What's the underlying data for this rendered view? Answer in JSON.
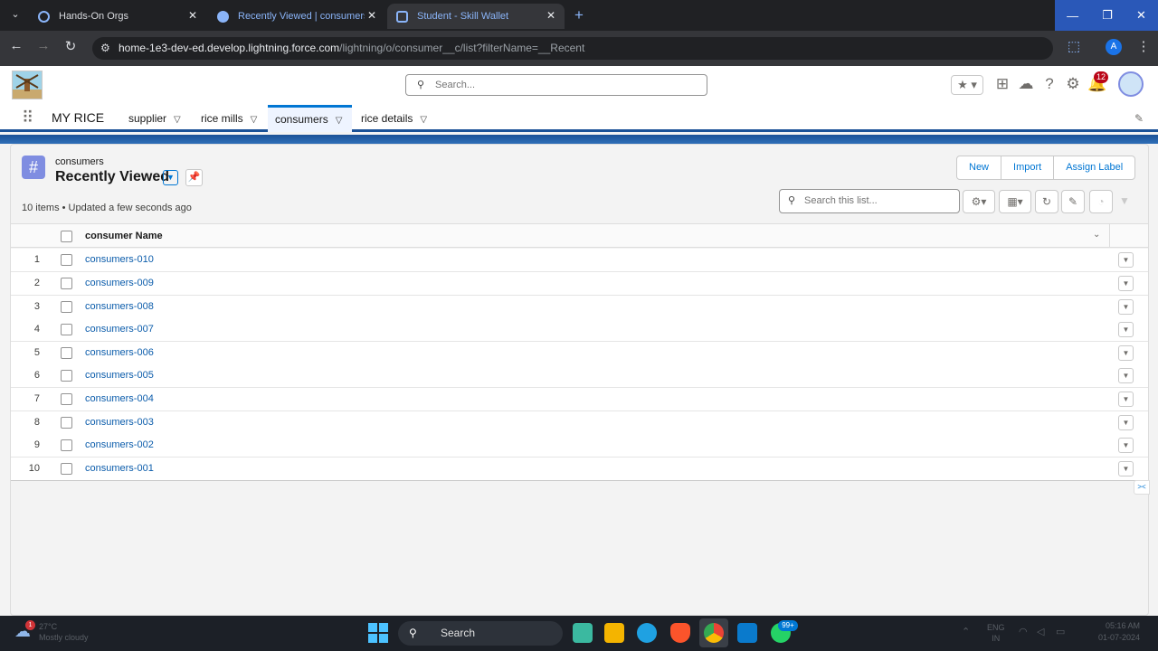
{
  "browser": {
    "tabs": [
      {
        "title": "Hands-On Orgs"
      },
      {
        "title": "Recently Viewed | consumers | S"
      },
      {
        "title": "Student - Skill Wallet"
      }
    ],
    "url_host": "home-1e3-dev-ed.develop.lightning.force.com",
    "url_path": "/lightning/o/consumer__c/list?filterName=__Recent",
    "profile_initial": "A"
  },
  "header": {
    "search_placeholder": "Search...",
    "notification_count": "12"
  },
  "nav": {
    "app_name": "MY RICE",
    "items": [
      {
        "label": "supplier"
      },
      {
        "label": "rice mills"
      },
      {
        "label": "consumers"
      },
      {
        "label": "rice details"
      }
    ]
  },
  "list": {
    "object_label": "consumers",
    "view_name": "Recently Viewed",
    "meta": "10 items • Updated a few seconds ago",
    "buttons": {
      "new": "New",
      "import": "Import",
      "assign_label": "Assign Label"
    },
    "search_placeholder": "Search this list...",
    "column_header": "consumer Name",
    "rows": [
      {
        "num": "1",
        "name": "consumers-010"
      },
      {
        "num": "2",
        "name": "consumers-009"
      },
      {
        "num": "3",
        "name": "consumers-008"
      },
      {
        "num": "4",
        "name": "consumers-007"
      },
      {
        "num": "5",
        "name": "consumers-006"
      },
      {
        "num": "6",
        "name": "consumers-005"
      },
      {
        "num": "7",
        "name": "consumers-004"
      },
      {
        "num": "8",
        "name": "consumers-003"
      },
      {
        "num": "9",
        "name": "consumers-002"
      },
      {
        "num": "10",
        "name": "consumers-001"
      }
    ]
  },
  "taskbar": {
    "weather_temp": "27°C",
    "weather_desc": "Mostly cloudy",
    "weather_badge": "1",
    "search_label": "Search",
    "whatsapp_badge": "99+",
    "lang": "ENG",
    "region": "IN",
    "time": "05:16 AM",
    "date": "01-07-2024"
  }
}
